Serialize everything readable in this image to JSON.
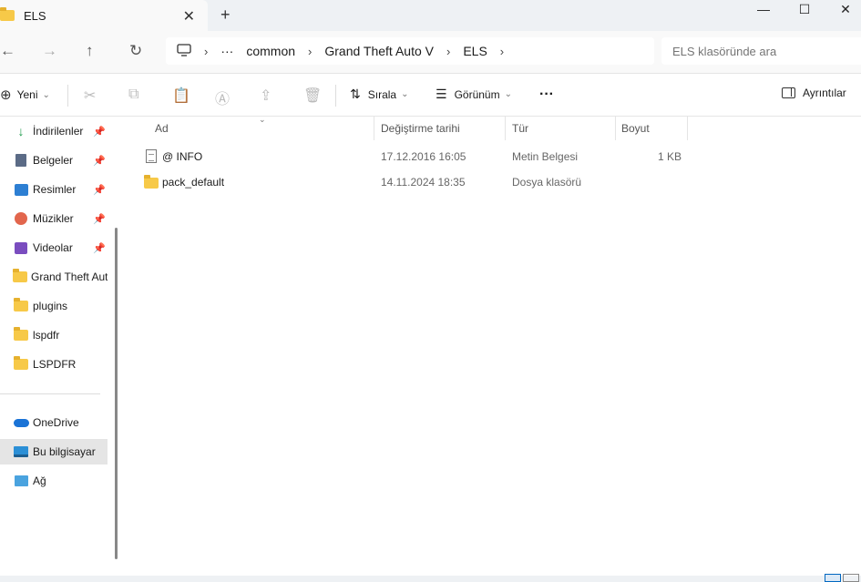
{
  "window": {
    "tab_title": "ELS",
    "close_tab_glyph": "✕",
    "new_tab_glyph": "+",
    "minimize_glyph": "—",
    "maximize_glyph": "☐",
    "close_glyph": "✕"
  },
  "nav": {
    "back_glyph": "←",
    "forward_glyph": "→",
    "up_glyph": "↑",
    "refresh_glyph": "↻",
    "address": {
      "overflow": "···",
      "crumbs": [
        "common",
        "Grand Theft Auto V",
        "ELS"
      ],
      "chevron": "›"
    },
    "search_placeholder": "ELS klasöründe ara"
  },
  "toolbar": {
    "new_label": "Yeni",
    "sort_label": "Sırala",
    "view_label": "Görünüm",
    "more_glyph": "···",
    "details_label": "Ayrıntılar",
    "dropdown_glyph": "⌄"
  },
  "sidebar": {
    "quick_access": [
      {
        "label": "İndirilenler",
        "icon": "downloads-icon",
        "pinned": true
      },
      {
        "label": "Belgeler",
        "icon": "documents-icon",
        "pinned": true
      },
      {
        "label": "Resimler",
        "icon": "pictures-icon",
        "pinned": true
      },
      {
        "label": "Müzikler",
        "icon": "music-icon",
        "pinned": true
      },
      {
        "label": "Videolar",
        "icon": "videos-icon",
        "pinned": true
      },
      {
        "label": "Grand Theft Aut",
        "icon": "folder-icon",
        "pinned": false
      },
      {
        "label": "plugins",
        "icon": "folder-icon",
        "pinned": false
      },
      {
        "label": "lspdfr",
        "icon": "folder-icon",
        "pinned": false
      },
      {
        "label": "LSPDFR",
        "icon": "folder-icon",
        "pinned": false
      }
    ],
    "locations": [
      {
        "label": "OneDrive",
        "icon": "onedrive-icon"
      },
      {
        "label": "Bu bilgisayar",
        "icon": "this-pc-icon",
        "selected": true
      },
      {
        "label": "Ağ",
        "icon": "network-icon"
      }
    ]
  },
  "columns": {
    "name": "Ad",
    "modified": "Değiştirme tarihi",
    "type": "Tür",
    "size": "Boyut"
  },
  "files": [
    {
      "name": "@ INFO",
      "modified": "17.12.2016 16:05",
      "type": "Metin Belgesi",
      "size": "1 KB",
      "icon": "text-document-icon"
    },
    {
      "name": "pack_default",
      "modified": "14.11.2024 18:35",
      "type": "Dosya klasörü",
      "size": "",
      "icon": "folder-icon"
    }
  ],
  "colors": {
    "accent": "#0067c0",
    "folder": "#f7c948",
    "selected_bg": "#e5e5e5"
  }
}
